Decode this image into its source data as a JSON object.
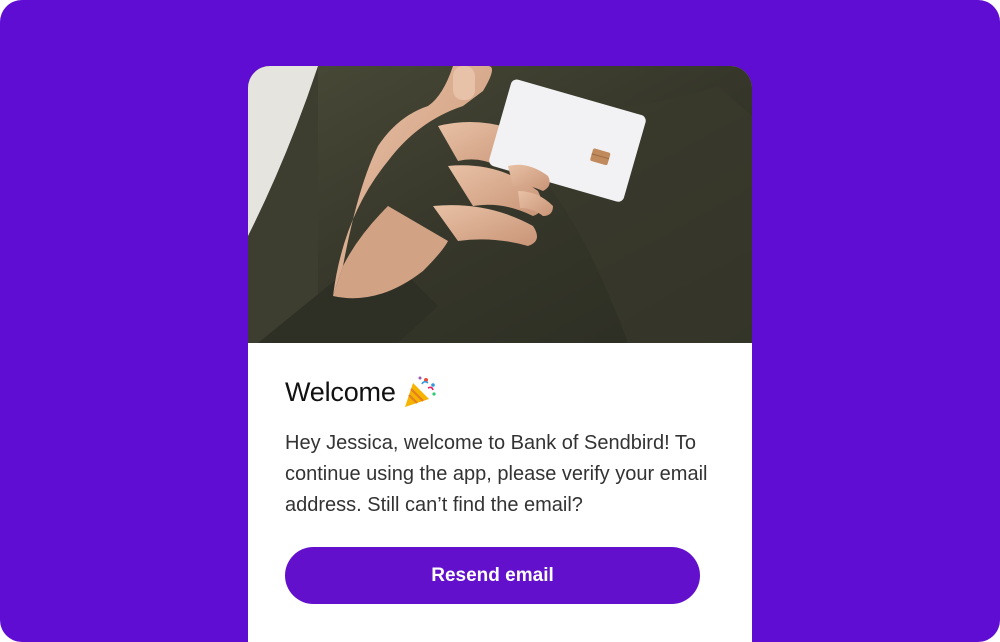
{
  "welcome_card": {
    "title": "Welcome",
    "emoji_icon": "party-popper-icon",
    "message": "Hey Jessica, welcome to Bank of Sendbird! To continue using the app, please verify your email address. Still can’t find the email?",
    "resend_button_label": "Resend email"
  },
  "colors": {
    "background": "#5f0dd2",
    "card": "#ffffff",
    "button": "#6210cc",
    "button_text": "#ffffff",
    "title_text": "#111111",
    "body_text": "#333333"
  }
}
